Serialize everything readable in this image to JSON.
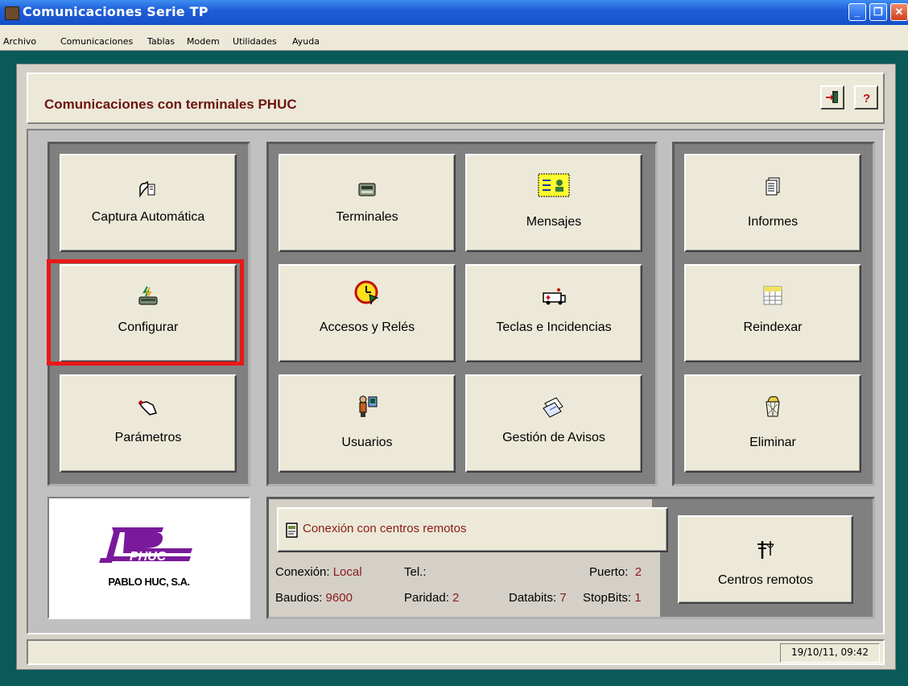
{
  "window": {
    "title": "Comunicaciones Serie TP"
  },
  "menu": [
    "Archivo",
    "Comunicaciones",
    "Tablas",
    "Modem",
    "Utilidades",
    "Ayuda"
  ],
  "header": {
    "title": "Comunicaciones con terminales PHUC"
  },
  "buttons": {
    "captura": "Captura Automática",
    "configurar": "Configurar",
    "parametros": "Parámetros",
    "terminales": "Terminales",
    "mensajes": "Mensajes",
    "accesos": "Accesos y Relés",
    "teclas": "Teclas e Incidencias",
    "usuarios": "Usuarios",
    "avisos": "Gestión de Avisos",
    "informes": "Informes",
    "reindexar": "Reindexar",
    "eliminar": "Eliminar",
    "centros": "Centros remotos"
  },
  "logo": {
    "brand": "PHUC",
    "company": "PABLO HUC, S.A."
  },
  "remote": {
    "title": "Conexión con centros remotos",
    "conexion_label": "Conexión:",
    "conexion_value": "Local",
    "tel_label": "Tel.:",
    "puerto_label": "Puerto:",
    "puerto_value": "2",
    "baudios_label": "Baudios:",
    "baudios_value": "9600",
    "paridad_label": "Paridad:",
    "paridad_value": "2",
    "databits_label": "Databits:",
    "databits_value": "7",
    "stopbits_label": "StopBits:",
    "stopbits_value": "1"
  },
  "status": {
    "datetime": "19/10/11, 09:42"
  },
  "colors": {
    "highlight": "#e81818",
    "header_text": "#6d1414",
    "value_text": "#8b1a1a"
  }
}
